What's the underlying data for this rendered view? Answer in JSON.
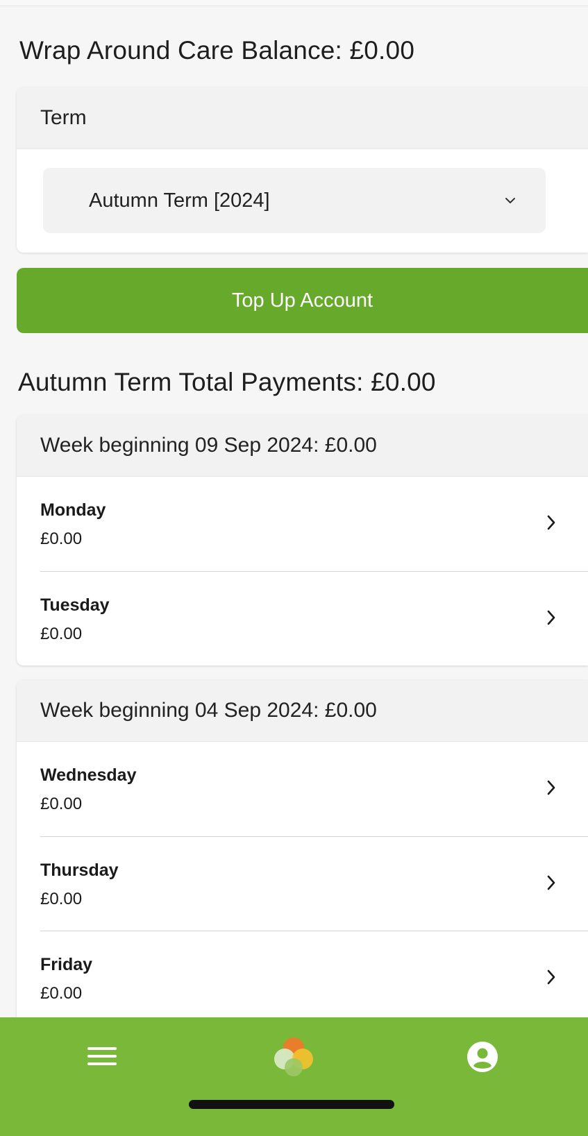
{
  "balance": {
    "title": "Wrap Around Care Balance: £0.00"
  },
  "term": {
    "header": "Term",
    "selected": "Autumn Term [2024]"
  },
  "topup": {
    "label": "Top Up Account"
  },
  "total": {
    "title": "Autumn Term Total Payments: £0.00"
  },
  "weeks": [
    {
      "header": "Week beginning 09 Sep 2024: £0.00",
      "days": [
        {
          "name": "Monday",
          "amount": "£0.00"
        },
        {
          "name": "Tuesday",
          "amount": "£0.00"
        }
      ]
    },
    {
      "header": "Week beginning 04 Sep 2024: £0.00",
      "days": [
        {
          "name": "Wednesday",
          "amount": "£0.00"
        },
        {
          "name": "Thursday",
          "amount": "£0.00"
        },
        {
          "name": "Friday",
          "amount": "£0.00"
        }
      ]
    }
  ],
  "nav": {
    "items": [
      {
        "icon": "hamburger-menu-icon"
      },
      {
        "icon": "app-logo-icon"
      },
      {
        "icon": "user-profile-icon"
      }
    ]
  },
  "colors": {
    "accent_green": "#67a92a",
    "nav_green": "#7ab83a",
    "card_header": "#f2f2f2"
  }
}
